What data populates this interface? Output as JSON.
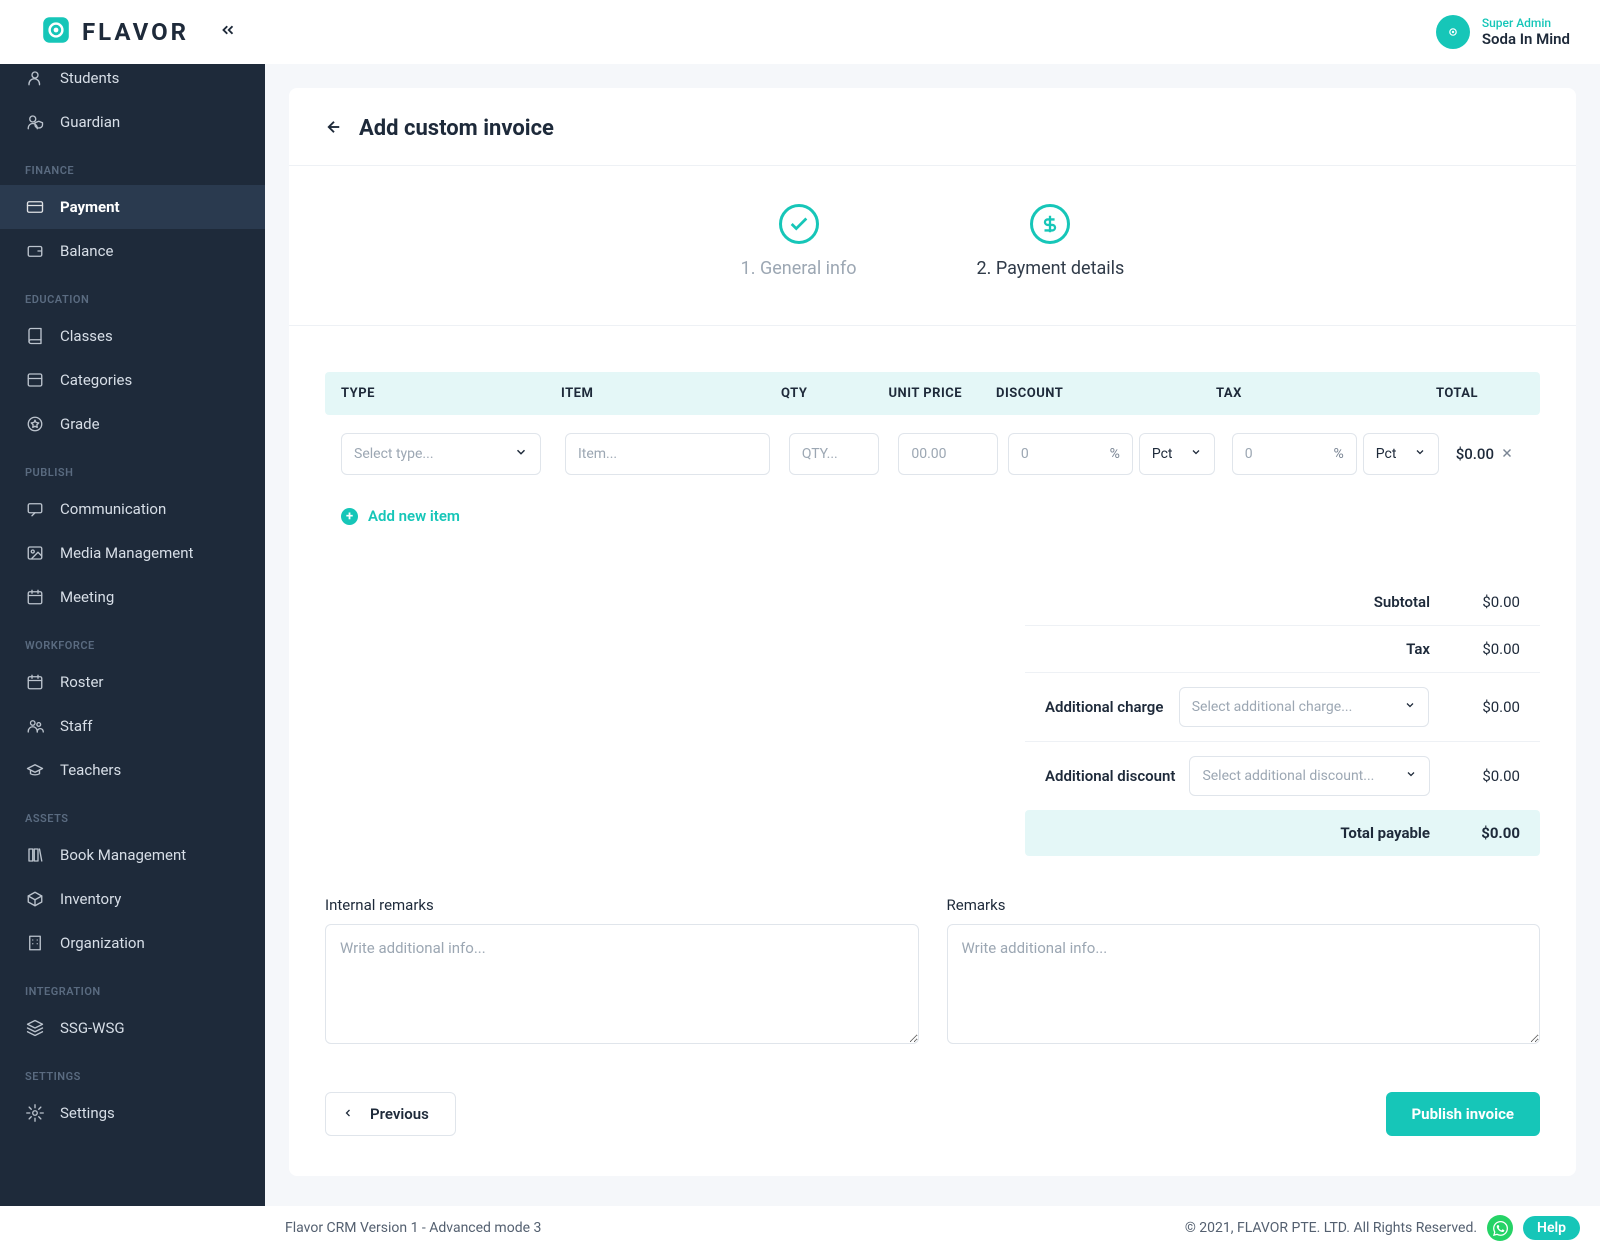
{
  "header": {
    "logo_text": "FLAVOR",
    "user_role": "Super Admin",
    "user_name": "Soda In Mind"
  },
  "sidebar": {
    "sections": [
      {
        "items": [
          {
            "icon": "user-icon",
            "label": "Students",
            "partial": true
          },
          {
            "icon": "user-shield-icon",
            "label": "Guardian"
          }
        ]
      },
      {
        "label": "FINANCE",
        "items": [
          {
            "icon": "card-icon",
            "label": "Payment",
            "active": true
          },
          {
            "icon": "wallet-icon",
            "label": "Balance"
          }
        ]
      },
      {
        "label": "EDUCATION",
        "items": [
          {
            "icon": "book-icon",
            "label": "Classes"
          },
          {
            "icon": "folder-icon",
            "label": "Categories"
          },
          {
            "icon": "star-icon",
            "label": "Grade"
          }
        ]
      },
      {
        "label": "PUBLISH",
        "items": [
          {
            "icon": "chat-icon",
            "label": "Communication"
          },
          {
            "icon": "image-icon",
            "label": "Media Management"
          },
          {
            "icon": "calendar-icon",
            "label": "Meeting"
          }
        ]
      },
      {
        "label": "WORKFORCE",
        "items": [
          {
            "icon": "calendar-icon",
            "label": "Roster"
          },
          {
            "icon": "group-icon",
            "label": "Staff"
          },
          {
            "icon": "cap-icon",
            "label": "Teachers"
          }
        ]
      },
      {
        "label": "ASSETS",
        "items": [
          {
            "icon": "books-icon",
            "label": "Book Management"
          },
          {
            "icon": "box-icon",
            "label": "Inventory"
          },
          {
            "icon": "building-icon",
            "label": "Organization"
          }
        ]
      },
      {
        "label": "INTEGRATION",
        "items": [
          {
            "icon": "layers-icon",
            "label": "SSG-WSG"
          }
        ]
      },
      {
        "label": "SETTINGS",
        "items": [
          {
            "icon": "gear-icon",
            "label": "Settings"
          }
        ]
      }
    ]
  },
  "page": {
    "title": "Add custom invoice",
    "steps": {
      "step1": "1. General info",
      "step2": "2. Payment details"
    },
    "columns": {
      "type": "TYPE",
      "item": "ITEM",
      "qty": "QTY",
      "unit": "UNIT PRICE",
      "disc": "DISCOUNT",
      "tax": "TAX",
      "total": "TOTAL"
    },
    "row": {
      "type_placeholder": "Select type...",
      "item_placeholder": "Item...",
      "qty_placeholder": "QTY...",
      "unit_placeholder": "00.00",
      "disc_placeholder": "0",
      "disc_suffix": "%",
      "disc_unit": "Pct",
      "tax_placeholder": "0",
      "tax_suffix": "%",
      "tax_unit": "Pct",
      "total": "$0.00"
    },
    "add_item": "Add new item",
    "summary": {
      "subtotal_label": "Subtotal",
      "subtotal_val": "$0.00",
      "tax_label": "Tax",
      "tax_val": "$0.00",
      "addcharge_label": "Additional charge",
      "addcharge_ph": "Select additional charge...",
      "addcharge_val": "$0.00",
      "adddisc_label": "Additional discount",
      "adddisc_ph": "Select additional discount...",
      "adddisc_val": "$0.00",
      "total_label": "Total payable",
      "total_val": "$0.00"
    },
    "remarks": {
      "internal_label": "Internal remarks",
      "internal_ph": "Write additional info...",
      "public_label": "Remarks",
      "public_ph": "Write additional info..."
    },
    "actions": {
      "prev": "Previous",
      "publish": "Publish invoice"
    }
  },
  "footer": {
    "left": "Flavor CRM Version 1 - Advanced mode 3",
    "right": "© 2021, FLAVOR PTE. LTD. All Rights Reserved.",
    "help": "Help"
  }
}
